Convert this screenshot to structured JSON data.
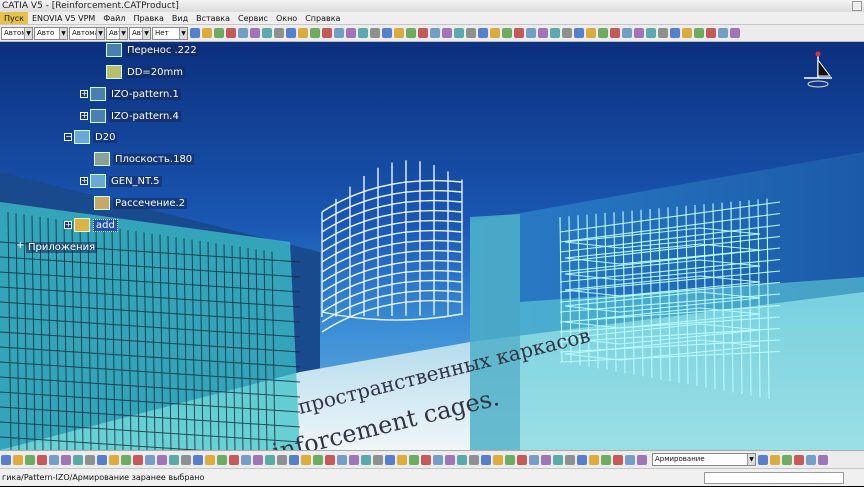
{
  "window": {
    "title": "CATIA V5 - [Reinforcement.CATProduct]"
  },
  "menu": {
    "items": [
      {
        "label": "Пуск",
        "active": true
      },
      {
        "label": "ENOVIA V5 VPM"
      },
      {
        "label": "Файл"
      },
      {
        "label": "Правка"
      },
      {
        "label": "Вид"
      },
      {
        "label": "Вставка"
      },
      {
        "label": "Сервис"
      },
      {
        "label": "Окно"
      },
      {
        "label": "Справка"
      }
    ]
  },
  "toolbar_top": {
    "combos": [
      "Автомат",
      "Авто",
      "Автомат",
      "Авт",
      "Авт",
      "Нет"
    ]
  },
  "tree": {
    "nodes": [
      {
        "label": "Перенос .222",
        "icon": "translate-icon"
      },
      {
        "label": "DD=20mm",
        "icon": "parameter-icon"
      },
      {
        "label": "IZO-pattern.1",
        "icon": "pattern-icon"
      },
      {
        "label": "IZO-pattern.4",
        "icon": "pattern-icon"
      },
      {
        "label": "D20",
        "icon": "geometric-set-icon"
      },
      {
        "label": "Плоскость.180",
        "icon": "plane-icon"
      },
      {
        "label": "GEN_NT.5",
        "icon": "geometric-set-icon"
      },
      {
        "label": "Рассечение.2",
        "icon": "split-icon"
      },
      {
        "label": "add",
        "icon": "user-feature-icon"
      },
      {
        "label": "Приложения",
        "icon": ""
      }
    ]
  },
  "document_text": {
    "line1": "пространственных каркасов",
    "line2": "reinforcement cages."
  },
  "toolbar_bottom": {
    "dropdown_value": "Армирование"
  },
  "status": {
    "text": "гика/Pattern-IZO/Армирование заранее выбрано"
  },
  "colors": {
    "viewport_top": "#0c2f7e",
    "viewport_bottom": "#6bb6da",
    "cage_cyan": "#7ff0ff",
    "menu_active": "#e6c24a"
  }
}
